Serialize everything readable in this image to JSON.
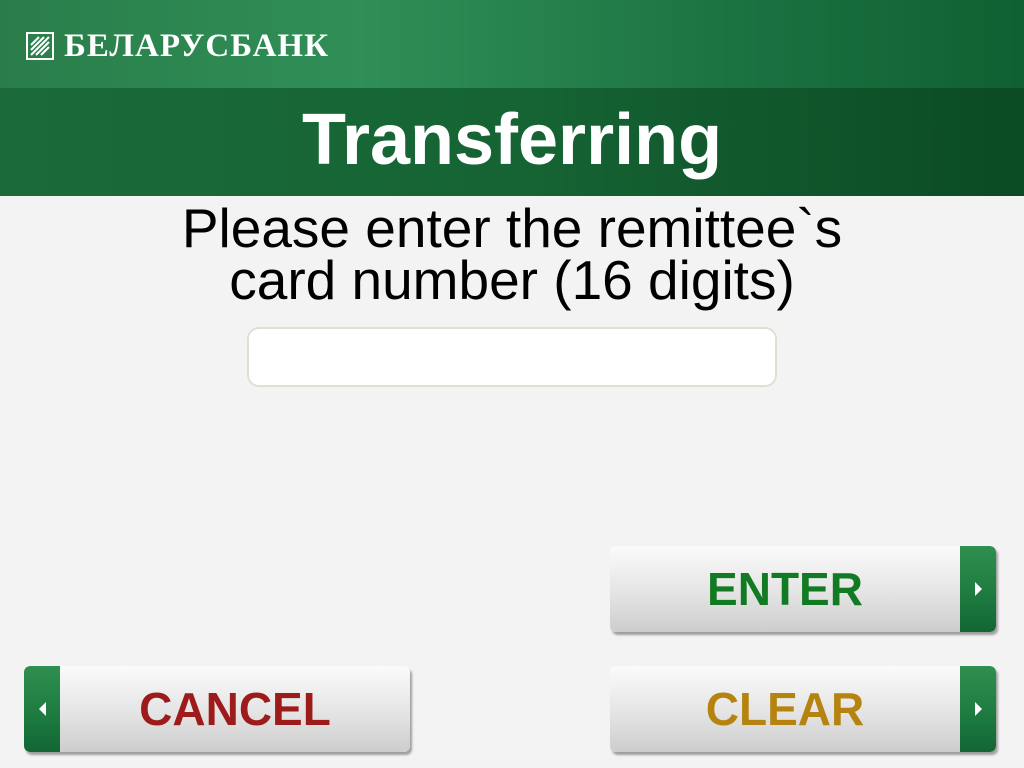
{
  "header": {
    "bank_name": "БЕЛАРУСБАНК",
    "logo_icon": "belarusbank-logo-icon",
    "title": "Transferring"
  },
  "prompt": {
    "line1": "Please enter the remittee`s",
    "line2": "card number (16 digits)"
  },
  "card_input": {
    "value": ""
  },
  "buttons": {
    "enter": {
      "label": "ENTER",
      "icon": "arrow-right-icon"
    },
    "clear": {
      "label": "CLEAR",
      "icon": "arrow-right-icon"
    },
    "cancel": {
      "label": "CANCEL",
      "icon": "arrow-left-icon"
    }
  },
  "colors": {
    "brand_green": "#2f8f56",
    "title_green": "#166434",
    "enter_text": "#137a24",
    "clear_text": "#b58410",
    "cancel_text": "#9d1b1b"
  }
}
